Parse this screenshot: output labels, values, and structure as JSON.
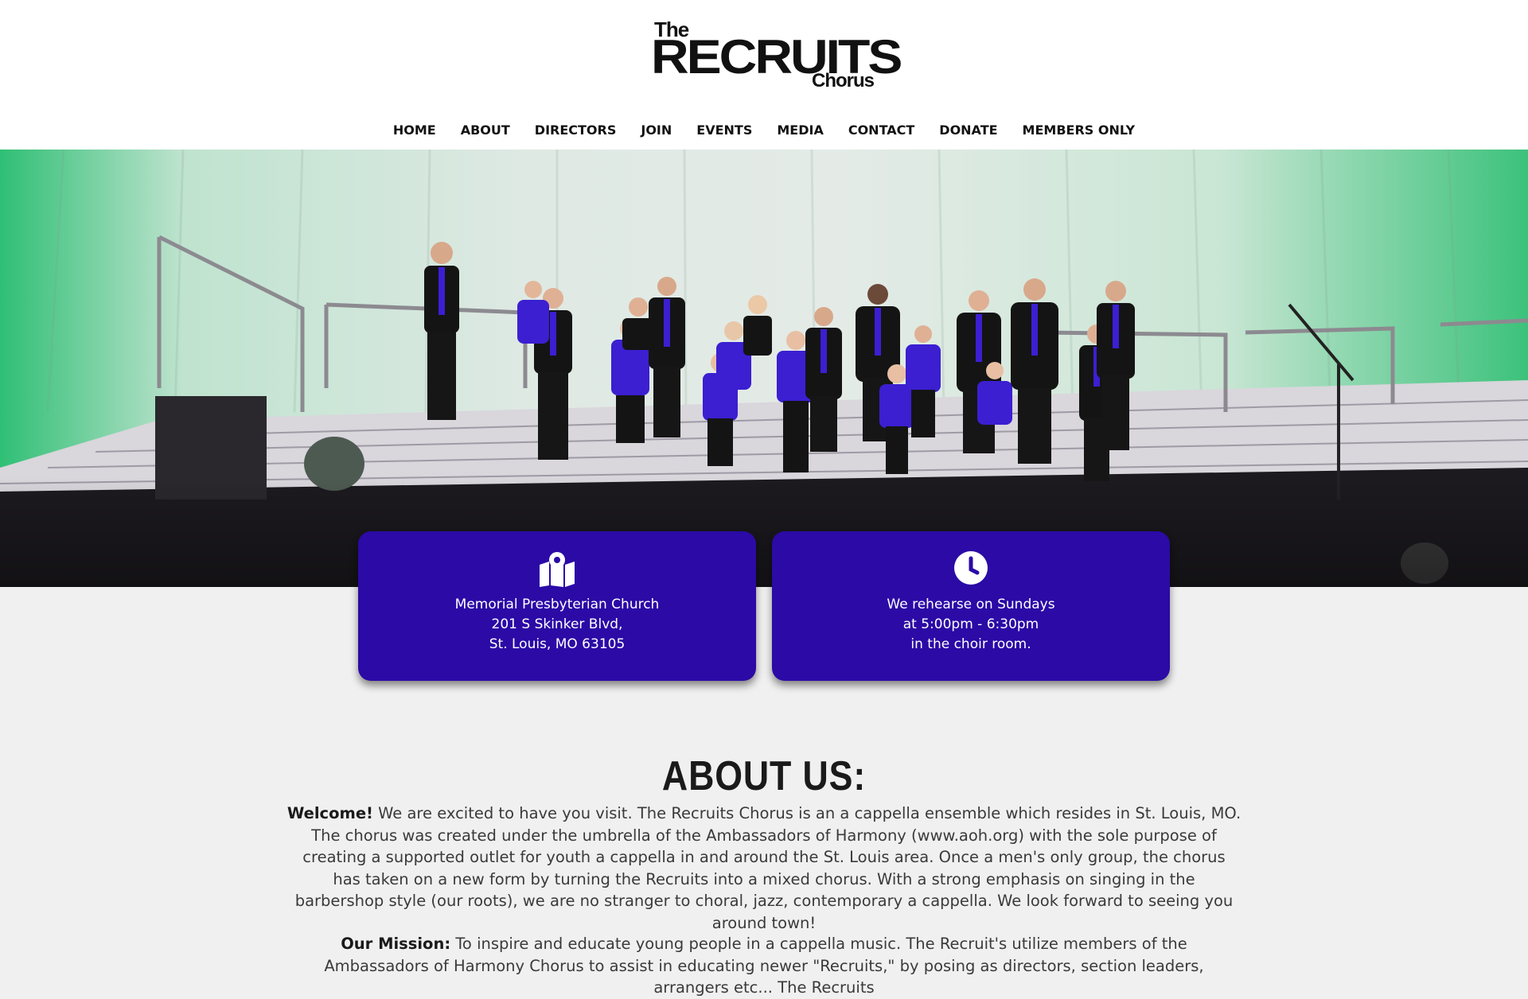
{
  "brand": {
    "logo_the": "The",
    "logo_main": "RECRUITS",
    "logo_chorus": "Chorus"
  },
  "nav": {
    "items": [
      "HOME",
      "ABOUT",
      "DIRECTORS",
      "JOIN",
      "EVENTS",
      "MEDIA",
      "CONTACT",
      "DONATE",
      "MEMBERS ONLY"
    ]
  },
  "hero": {
    "image_alt": "hero-photo-icon"
  },
  "cards": {
    "location": {
      "icon": "map-icon",
      "line1": "Memorial Presbyterian Church",
      "line2": "201 S Skinker Blvd,",
      "line3": "St. Louis, MO 63105"
    },
    "rehearsal": {
      "icon": "clock-icon",
      "line1": "We rehearse on Sundays",
      "line2": "at 5:00pm - 6:30pm",
      "line3": "in the choir room."
    }
  },
  "about": {
    "title": "ABOUT US:",
    "welcome_label": "Welcome!",
    "welcome_text": " We are excited to have you visit. The Recruits Chorus is an a cappella ensemble which resides in St. Louis, MO. The chorus was created under the umbrella of the Ambassadors of Harmony (www.aoh.org) with the sole purpose of creating a supported outlet for youth a cappella in and around the St. Louis area. Once a men's only group, the chorus has taken on a new form by turning the Recruits into a mixed chorus. With a strong emphasis on singing in the barbershop style (our roots), we are no stranger to choral, jazz, contemporary a cappella. We look forward to seeing you around town!",
    "mission_label": "Our Mission:",
    "mission_text": " To inspire and educate young people in a cappella music. The Recruit's utilize members of the Ambassadors of Harmony Chorus to assist in educating newer \"Recruits,\" by posing as directors, section leaders, arrangers etc... The Recruits"
  },
  "colors": {
    "card_bg": "#2b0aa6",
    "page_bg": "#f0f0f0",
    "header_bg": "#ffffff",
    "jacket_blue": "#3b1fd1"
  }
}
